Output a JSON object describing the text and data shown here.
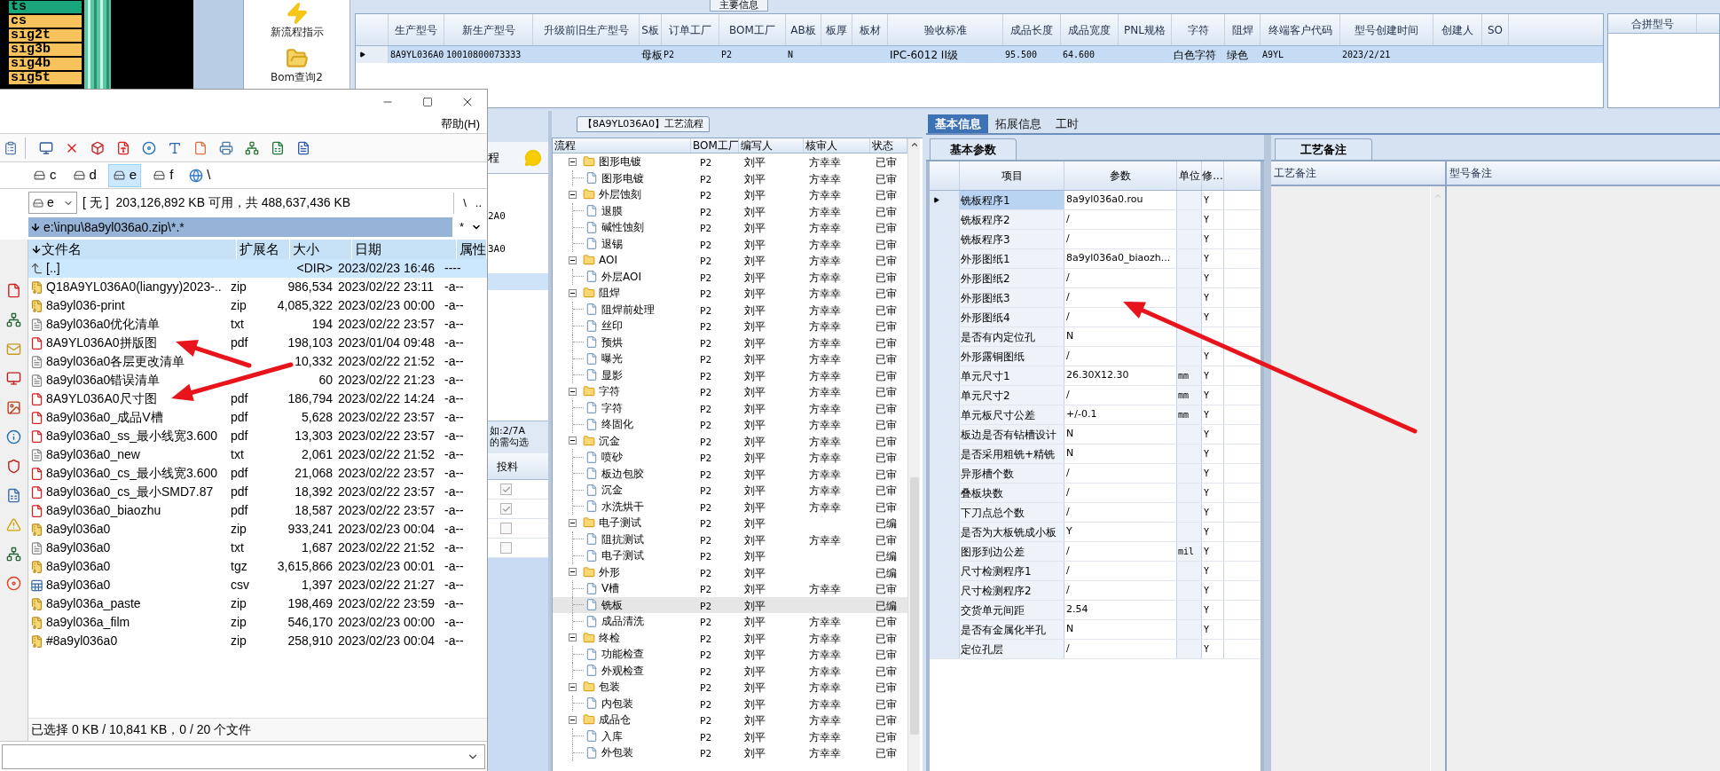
{
  "terminal_list": [
    {
      "label": "ts",
      "color": "#1aa67c"
    },
    {
      "label": "cs",
      "color": "#f8c35c"
    },
    {
      "label": "sig2t",
      "color": "#f8c35c"
    },
    {
      "label": "sig3b",
      "color": "#f8c35c"
    },
    {
      "label": "sig4b",
      "color": "#f8c35c"
    },
    {
      "label": "sig5t",
      "color": "#f8c35c"
    }
  ],
  "toolbar": [
    {
      "label": "新流程指示",
      "kind": "lightning"
    },
    {
      "label": "Bom查询2",
      "kind": "folder"
    }
  ],
  "main_info": {
    "title": "主要信息",
    "columns": [
      "生产型号",
      "新生产型号",
      "升级前旧生产型号",
      "S板",
      "订单工厂",
      "BOM工厂",
      "AB板",
      "板厚",
      "板材",
      "验收标准",
      "成品长度",
      "成品宽度",
      "PNL规格",
      "字符",
      "阻焊",
      "终端客户代码",
      "型号创建时间",
      "创建人",
      "SO"
    ],
    "rows": [
      {
        "selected": true,
        "cells": [
          "8A9YL036A0",
          "10010800073333",
          null,
          "母板",
          "P2",
          "P2",
          "N",
          null,
          null,
          "IPC-6012 II级",
          "95.500",
          "64.600",
          null,
          "白色字符",
          "绿色",
          "A9YL",
          "2023/2/21",
          null,
          null
        ]
      }
    ]
  },
  "merge_panel": {
    "columns": [
      "合拼型号"
    ]
  },
  "covered_panel": {
    "title": "程",
    "items": [
      {
        "text": "2A0",
        "selected": false
      },
      {
        "text": "3A0",
        "selected": false
      },
      {
        "selected": true
      }
    ],
    "hint": [
      "如:2/7A",
      "的需勾选"
    ],
    "column": "投料",
    "checkboxes": [
      {
        "checked": true
      },
      {
        "checked": true
      },
      {
        "checked": false
      },
      {
        "checked": false
      }
    ]
  },
  "process": {
    "title": "【8A9YL036A0】工艺流程",
    "columns": [
      "流程",
      "BOM工厂",
      "编写人",
      "核审人",
      "状态"
    ],
    "tree": [
      {
        "name": "图形电镀",
        "bom": "P2",
        "writer": "刘平",
        "reviewer": "方幸幸",
        "status": "已审",
        "selected": false,
        "expanded": true,
        "children": [
          {
            "name": "图形电镀",
            "bom": "P2",
            "writer": "刘平",
            "reviewer": "方幸幸",
            "status": "已审",
            "selected": false
          }
        ]
      },
      {
        "name": "外层蚀刻",
        "bom": "P2",
        "writer": "刘平",
        "reviewer": "方幸幸",
        "status": "已审",
        "selected": false,
        "expanded": true,
        "children": [
          {
            "name": "退膜",
            "bom": "P2",
            "writer": "刘平",
            "reviewer": "方幸幸",
            "status": "已审",
            "selected": false
          },
          {
            "name": "碱性蚀刻",
            "bom": "P2",
            "writer": "刘平",
            "reviewer": "方幸幸",
            "status": "已审",
            "selected": false
          },
          {
            "name": "退锡",
            "bom": "P2",
            "writer": "刘平",
            "reviewer": "方幸幸",
            "status": "已审",
            "selected": false
          }
        ]
      },
      {
        "name": "AOI",
        "bom": "P2",
        "writer": "刘平",
        "reviewer": "方幸幸",
        "status": "已审",
        "selected": false,
        "expanded": true,
        "children": [
          {
            "name": "外层AOI",
            "bom": "P2",
            "writer": "刘平",
            "reviewer": "方幸幸",
            "status": "已审",
            "selected": false
          }
        ]
      },
      {
        "name": "阻焊",
        "bom": "P2",
        "writer": "刘平",
        "reviewer": "方幸幸",
        "status": "已审",
        "selected": false,
        "expanded": true,
        "children": [
          {
            "name": "阻焊前处理",
            "bom": "P2",
            "writer": "刘平",
            "reviewer": "方幸幸",
            "status": "已审",
            "selected": false
          },
          {
            "name": "丝印",
            "bom": "P2",
            "writer": "刘平",
            "reviewer": "方幸幸",
            "status": "已审",
            "selected": false
          },
          {
            "name": "预烘",
            "bom": "P2",
            "writer": "刘平",
            "reviewer": "方幸幸",
            "status": "已审",
            "selected": false
          },
          {
            "name": "曝光",
            "bom": "P2",
            "writer": "刘平",
            "reviewer": "方幸幸",
            "status": "已审",
            "selected": false
          },
          {
            "name": "显影",
            "bom": "P2",
            "writer": "刘平",
            "reviewer": "方幸幸",
            "status": "已审",
            "selected": false
          }
        ]
      },
      {
        "name": "字符",
        "bom": "P2",
        "writer": "刘平",
        "reviewer": "方幸幸",
        "status": "已审",
        "selected": false,
        "expanded": true,
        "children": [
          {
            "name": "字符",
            "bom": "P2",
            "writer": "刘平",
            "reviewer": "方幸幸",
            "status": "已审",
            "selected": false
          },
          {
            "name": "终固化",
            "bom": "P2",
            "writer": "刘平",
            "reviewer": "方幸幸",
            "status": "已审",
            "selected": false
          }
        ]
      },
      {
        "name": "沉金",
        "bom": "P2",
        "writer": "刘平",
        "reviewer": "方幸幸",
        "status": "已审",
        "selected": false,
        "expanded": true,
        "children": [
          {
            "name": "喷砂",
            "bom": "P2",
            "writer": "刘平",
            "reviewer": "方幸幸",
            "status": "已审",
            "selected": false
          },
          {
            "name": "板边包胶",
            "bom": "P2",
            "writer": "刘平",
            "reviewer": "方幸幸",
            "status": "已审",
            "selected": false
          },
          {
            "name": "沉金",
            "bom": "P2",
            "writer": "刘平",
            "reviewer": "方幸幸",
            "status": "已审",
            "selected": false
          },
          {
            "name": "水洗烘干",
            "bom": "P2",
            "writer": "刘平",
            "reviewer": "方幸幸",
            "status": "已审",
            "selected": false
          }
        ]
      },
      {
        "name": "电子测试",
        "bom": "P2",
        "writer": "刘平",
        "status": "已编",
        "selected": false,
        "expanded": true,
        "children": [
          {
            "name": "阻抗测试",
            "bom": "P2",
            "writer": "刘平",
            "reviewer": "方幸幸",
            "status": "已审",
            "selected": false
          },
          {
            "name": "电子测试",
            "bom": "P2",
            "writer": "刘平",
            "status": "已编",
            "selected": false
          }
        ]
      },
      {
        "name": "外形",
        "bom": "P2",
        "writer": "刘平",
        "status": "已编",
        "selected": false,
        "expanded": true,
        "children": [
          {
            "name": "V槽",
            "bom": "P2",
            "writer": "刘平",
            "reviewer": "方幸幸",
            "status": "已审",
            "selected": false
          },
          {
            "name": "铣板",
            "bom": "P2",
            "writer": "刘平",
            "status": "已编",
            "selected": true
          },
          {
            "name": "成品清洗",
            "bom": "P2",
            "writer": "刘平",
            "reviewer": "方幸幸",
            "status": "已审",
            "selected": false
          }
        ]
      },
      {
        "name": "终检",
        "bom": "P2",
        "writer": "刘平",
        "reviewer": "方幸幸",
        "status": "已审",
        "selected": false,
        "expanded": true,
        "children": [
          {
            "name": "功能检查",
            "bom": "P2",
            "writer": "刘平",
            "reviewer": "方幸幸",
            "status": "已审",
            "selected": false
          },
          {
            "name": "外观检查",
            "bom": "P2",
            "writer": "刘平",
            "reviewer": "方幸幸",
            "status": "已审",
            "selected": false
          }
        ]
      },
      {
        "name": "包装",
        "bom": "P2",
        "writer": "刘平",
        "reviewer": "方幸幸",
        "status": "已审",
        "selected": false,
        "expanded": true,
        "children": [
          {
            "name": "内包装",
            "bom": "P2",
            "writer": "刘平",
            "reviewer": "方幸幸",
            "status": "已审",
            "selected": false
          }
        ]
      },
      {
        "name": "成品仓",
        "bom": "P2",
        "writer": "刘平",
        "reviewer": "方幸幸",
        "status": "已审",
        "selected": false,
        "expanded": true,
        "children": [
          {
            "name": "入库",
            "bom": "P2",
            "writer": "刘平",
            "reviewer": "方幸幸",
            "status": "已审",
            "selected": false
          },
          {
            "name": "外包装",
            "bom": "P2",
            "writer": "刘平",
            "reviewer": "方幸幸",
            "status": "已审",
            "selected": false
          }
        ]
      }
    ]
  },
  "info_tabs": [
    {
      "label": "基本信息",
      "selected": true
    },
    {
      "label": "拓展信息",
      "selected": false
    },
    {
      "label": "工时",
      "selected": false
    }
  ],
  "params": {
    "tab": "基本参数",
    "columns": [
      "项目",
      "参数",
      "单位",
      "修..."
    ],
    "rows": [
      {
        "item": "铣板程序1",
        "value": "8a9yl036a0.rou",
        "flag": "Y",
        "selected": true
      },
      {
        "item": "铣板程序2",
        "value": "/",
        "flag": "Y",
        "selected": false
      },
      {
        "item": "铣板程序3",
        "value": "/",
        "flag": "Y",
        "selected": false
      },
      {
        "item": "外形图纸1",
        "value": "8a9yl036a0_biaozh...",
        "flag": "Y",
        "selected": false
      },
      {
        "item": "外形图纸2",
        "value": "/",
        "flag": "Y",
        "selected": false
      },
      {
        "item": "外形图纸3",
        "value": "/",
        "flag": "Y",
        "selected": false
      },
      {
        "item": "外形图纸4",
        "value": "/",
        "flag": "Y",
        "selected": false
      },
      {
        "item": "是否有内定位孔",
        "value": "N",
        "selected": false
      },
      {
        "item": "外形露铜图纸",
        "value": "/",
        "flag": "Y",
        "selected": false
      },
      {
        "item": "单元尺寸1",
        "value": "26.30X12.30",
        "unit": "mm",
        "flag": "Y",
        "selected": false
      },
      {
        "item": "单元尺寸2",
        "value": "/",
        "unit": "mm",
        "flag": "Y",
        "selected": false
      },
      {
        "item": "单元板尺寸公差",
        "value": "+/-0.1",
        "unit": "mm",
        "flag": "Y",
        "selected": false
      },
      {
        "item": "板边是否有钻槽设计",
        "value": "N",
        "flag": "Y",
        "selected": false
      },
      {
        "item": "是否采用粗铣+精铣",
        "value": "N",
        "flag": "Y",
        "selected": false
      },
      {
        "item": "异形槽个数",
        "value": "/",
        "flag": "Y",
        "selected": false
      },
      {
        "item": "叠板块数",
        "value": "/",
        "flag": "Y",
        "selected": false
      },
      {
        "item": "下刀点总个数",
        "value": "/",
        "flag": "Y",
        "selected": false
      },
      {
        "item": "是否为大板铣成小板",
        "value": "Y",
        "flag": "Y",
        "selected": false
      },
      {
        "item": "图形到边公差",
        "value": "/",
        "unit": "mil",
        "flag": "Y",
        "selected": false
      },
      {
        "item": "尺寸检测程序1",
        "value": "/",
        "flag": "Y",
        "selected": false
      },
      {
        "item": "尺寸检测程序2",
        "value": "/",
        "flag": "Y",
        "selected": false
      },
      {
        "item": "交货单元间距",
        "value": "2.54",
        "flag": "Y",
        "selected": false
      },
      {
        "item": "是否有金属化半孔",
        "value": "N",
        "flag": "Y",
        "selected": false
      },
      {
        "item": "定位孔层",
        "value": "/",
        "flag": "Y",
        "selected": false
      }
    ]
  },
  "notes": {
    "tab": "工艺备注",
    "columns": [
      "工艺备注",
      "型号备注"
    ]
  },
  "file_manager": {
    "menu": [
      "帮助(H)"
    ],
    "drives": [
      {
        "label": "c",
        "selected": false
      },
      {
        "label": "d",
        "selected": false
      },
      {
        "label": "e",
        "selected": true
      },
      {
        "label": "f",
        "selected": false
      },
      {
        "label": "\\",
        "selected": false
      }
    ],
    "drive_select": "e",
    "volume": "[ 无 ]",
    "free_space": "203,126,892 KB 可用，共 488,637,436 KB",
    "nav": [
      "\\",
      ".."
    ],
    "path": "e:\\inpu\\8a9yl036a0.zip\\*.*",
    "filter": "*",
    "columns": [
      "文件名",
      "扩展名",
      "大小",
      "日期",
      "属性"
    ],
    "files": [
      {
        "name": "[..]",
        "kind": "up",
        "size": "<DIR>",
        "date": "2023/02/23 16:46",
        "attr": "----",
        "selected": true
      },
      {
        "name": "Q18A9YL036A0(liangyy)2023-..",
        "ext": "zip",
        "kind": "zip",
        "size": "986,534",
        "date": "2023/02/22 23:11",
        "attr": "-a--",
        "selected": false
      },
      {
        "name": "8a9yl036-print",
        "ext": "zip",
        "kind": "zip",
        "size": "4,085,322",
        "date": "2023/02/23 00:00",
        "attr": "-a--",
        "selected": false
      },
      {
        "name": "8a9yl036a0优化清单",
        "ext": "txt",
        "kind": "txt",
        "size": "194",
        "date": "2023/02/22 23:57",
        "attr": "-a--",
        "selected": false
      },
      {
        "name": "8A9YL036A0拼版图",
        "ext": "pdf",
        "kind": "pdf",
        "size": "198,103",
        "date": "2023/01/04 09:48",
        "attr": "-a--",
        "selected": false
      },
      {
        "name": "8a9yl036a0各层更改清单",
        "kind": "txt",
        "size": "10,332",
        "date": "2023/02/22 21:52",
        "attr": "-a--",
        "selected": false
      },
      {
        "name": "8a9yl036a0错误清单",
        "kind": "txt",
        "size": "60",
        "date": "2023/02/22 21:23",
        "attr": "-a--",
        "selected": false
      },
      {
        "name": "8A9YL036A0尺寸图",
        "ext": "pdf",
        "kind": "pdf",
        "size": "186,794",
        "date": "2023/02/22 14:24",
        "attr": "-a--",
        "selected": false
      },
      {
        "name": "8a9yl036a0_成品V槽",
        "ext": "pdf",
        "kind": "pdf",
        "size": "5,628",
        "date": "2023/02/22 23:57",
        "attr": "-a--",
        "selected": false
      },
      {
        "name": "8a9yl036a0_ss_最小线宽3.600",
        "ext": "pdf",
        "kind": "pdf",
        "size": "13,303",
        "date": "2023/02/22 23:57",
        "attr": "-a--",
        "selected": false
      },
      {
        "name": "8a9yl036a0_new",
        "ext": "txt",
        "kind": "txt",
        "size": "2,061",
        "date": "2023/02/22 21:52",
        "attr": "-a--",
        "selected": false
      },
      {
        "name": "8a9yl036a0_cs_最小线宽3.600",
        "ext": "pdf",
        "kind": "pdf",
        "size": "21,068",
        "date": "2023/02/22 23:57",
        "attr": "-a--",
        "selected": false
      },
      {
        "name": "8a9yl036a0_cs_最小SMD7.87",
        "ext": "pdf",
        "kind": "pdf",
        "size": "18,392",
        "date": "2023/02/22 23:57",
        "attr": "-a--",
        "selected": false
      },
      {
        "name": "8a9yl036a0_biaozhu",
        "ext": "pdf",
        "kind": "pdf",
        "size": "18,587",
        "date": "2023/02/22 23:57",
        "attr": "-a--",
        "selected": false
      },
      {
        "name": "8a9yl036a0",
        "ext": "zip",
        "kind": "zip",
        "size": "933,241",
        "date": "2023/02/23 00:04",
        "attr": "-a--",
        "selected": false
      },
      {
        "name": "8a9yl036a0",
        "ext": "txt",
        "kind": "txt",
        "size": "1,687",
        "date": "2023/02/22 21:52",
        "attr": "-a--",
        "selected": false
      },
      {
        "name": "8a9yl036a0",
        "ext": "tgz",
        "kind": "zip",
        "size": "3,615,866",
        "date": "2023/02/23 00:01",
        "attr": "-a--",
        "selected": false
      },
      {
        "name": "8a9yl036a0",
        "ext": "csv",
        "kind": "csv",
        "size": "1,397",
        "date": "2023/02/22 21:27",
        "attr": "-a--",
        "selected": false
      },
      {
        "name": "8a9yl036a_paste",
        "ext": "zip",
        "kind": "zip",
        "size": "198,469",
        "date": "2023/02/22 23:59",
        "attr": "-a--",
        "selected": false
      },
      {
        "name": "8a9yl036a_film",
        "ext": "zip",
        "kind": "zip",
        "size": "546,170",
        "date": "2023/02/23 00:00",
        "attr": "-a--",
        "selected": false
      },
      {
        "name": "#8a9yl036a0",
        "ext": "zip",
        "kind": "zip",
        "size": "258,910",
        "date": "2023/02/23 00:04",
        "attr": "-a--",
        "selected": false
      }
    ],
    "status": "已选择 0 KB / 10,841 KB，0 / 20 个文件"
  }
}
